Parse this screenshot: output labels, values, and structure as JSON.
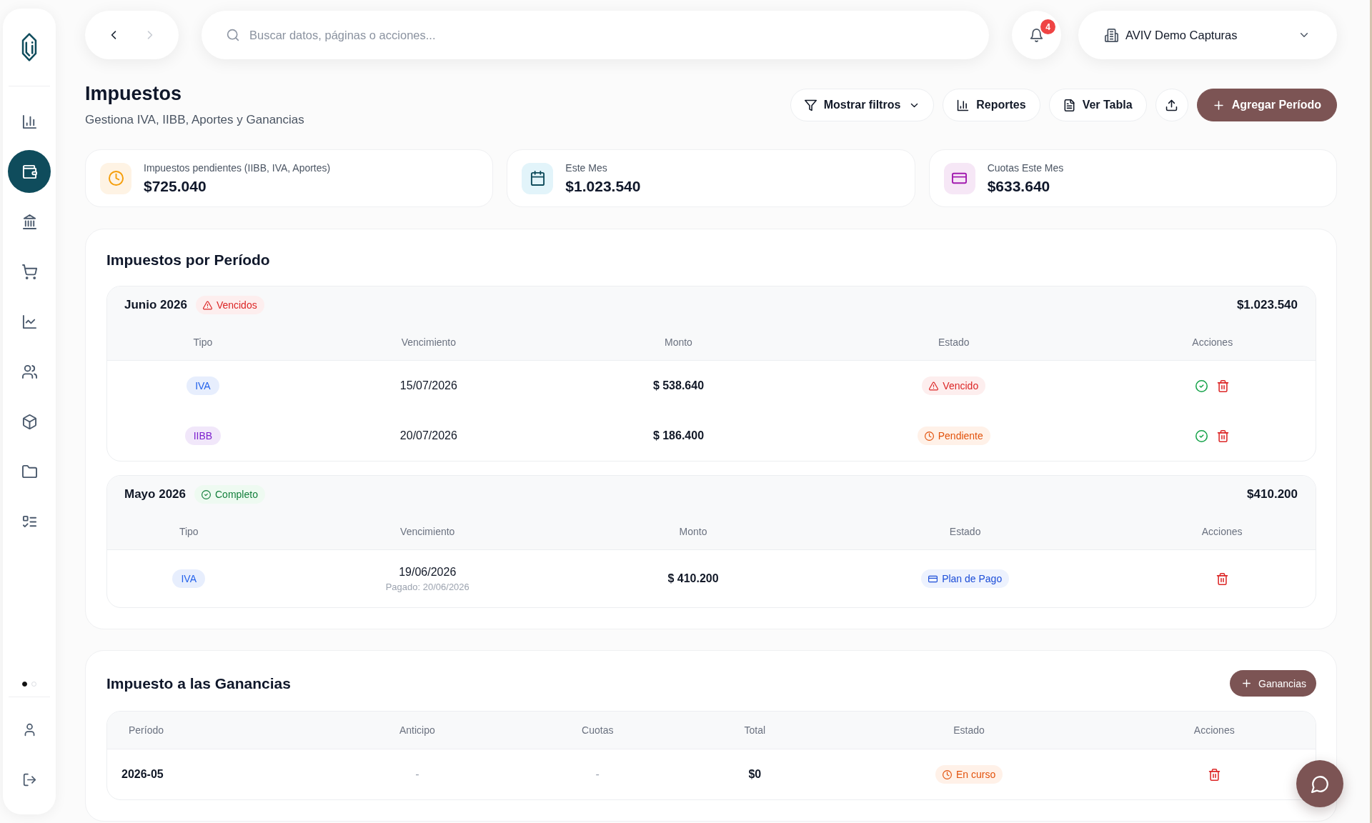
{
  "sidebar": {
    "items": [
      {
        "selected": false
      },
      {
        "selected": true
      },
      {
        "selected": false
      },
      {
        "selected": false
      },
      {
        "selected": false
      },
      {
        "selected": false
      },
      {
        "selected": false
      },
      {
        "selected": false
      },
      {
        "selected": false
      }
    ],
    "pages": [
      {
        "selected": true
      },
      {
        "selected": false
      }
    ]
  },
  "topbar": {
    "history": [
      {
        "disabled": false
      },
      {
        "disabled": true
      }
    ],
    "search": {
      "placeholder": "Buscar datos, páginas o acciones..."
    },
    "notifications": {
      "count": "4"
    },
    "organization": "AVIV Demo Capturas"
  },
  "header": {
    "title": "Impuestos",
    "subtitle": "Gestiona IVA, IIBB, Aportes y Ganancias",
    "actions": [
      {
        "kind": "dropdown",
        "label": "Mostrar filtros"
      },
      {
        "kind": "outline",
        "label": "Reportes"
      },
      {
        "kind": "outline",
        "label": "Ver Tabla"
      },
      {
        "kind": "icon"
      },
      {
        "kind": "primary",
        "label": "Agregar Período"
      }
    ]
  },
  "stats": [
    {
      "kind": "pending",
      "label": "Impuestos pendientes (IIBB, IVA, Aportes)",
      "value": "$725.040"
    },
    {
      "kind": "month",
      "label": "Este Mes",
      "value": "$1.023.540"
    },
    {
      "kind": "installments",
      "label": "Cuotas Este Mes",
      "value": "$633.640"
    }
  ],
  "periods": {
    "title": "Impuestos por Período",
    "groups": [
      {
        "period": "Junio 2026",
        "status": {
          "kind": "overdue",
          "label": "Vencidos"
        },
        "total": "$1.023.540",
        "columns": [
          "Tipo",
          "Vencimiento",
          "Monto",
          "Estado",
          "Acciones"
        ],
        "rows": [
          {
            "type": {
              "label": "IVA",
              "color": "#2563eb"
            },
            "due": "15/07/2026",
            "amount": "$ 538.640",
            "status": {
              "kind": "overdue",
              "label": "Vencido"
            },
            "actions": [
              {
                "kind": "approve"
              },
              {
                "kind": "delete"
              }
            ]
          },
          {
            "type": {
              "label": "IIBB",
              "color": "#7e22ce"
            },
            "due": "20/07/2026",
            "amount": "$ 186.400",
            "status": {
              "kind": "pending",
              "label": "Pendiente"
            },
            "actions": [
              {
                "kind": "approve"
              },
              {
                "kind": "delete"
              }
            ]
          }
        ]
      },
      {
        "period": "Mayo 2026",
        "status": {
          "kind": "complete",
          "label": "Completo"
        },
        "total": "$410.200",
        "columns": [
          "Tipo",
          "Vencimiento",
          "Monto",
          "Estado",
          "Acciones"
        ],
        "rows": [
          {
            "type": {
              "label": "IVA",
              "color": "#2563eb"
            },
            "due": "19/06/2026",
            "paid_note": "Pagado: 20/06/2026",
            "amount": "$ 410.200",
            "status": {
              "kind": "plan",
              "label": "Plan de Pago"
            },
            "actions": [
              {
                "kind": "delete"
              }
            ]
          }
        ]
      }
    ]
  },
  "earnings": {
    "title": "Impuesto a las Ganancias",
    "add_button": "Ganancias",
    "columns": [
      "Período",
      "Anticipo",
      "Cuotas",
      "Total",
      "Estado",
      "Acciones"
    ],
    "rows": [
      {
        "period": "2026-05",
        "advance": "-",
        "installments": "-",
        "total": "$0",
        "status": {
          "kind": "in_progress",
          "label": "En curso"
        },
        "actions": [
          {
            "kind": "delete"
          }
        ]
      }
    ]
  }
}
